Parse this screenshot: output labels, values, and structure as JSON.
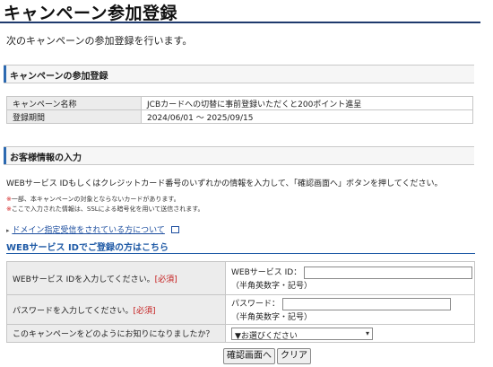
{
  "page": {
    "title": "キャンペーン参加登録",
    "intro": "次のキャンペーンの参加登録を行います。"
  },
  "campaign_section": {
    "heading": "キャンペーンの参加登録",
    "rows": [
      {
        "label": "キャンペーン名称",
        "value": "JCBカードへの切替に事前登録いただくと200ポイント進呈"
      },
      {
        "label": "登録期間",
        "value": "2024/06/01 ～ 2025/09/15"
      }
    ]
  },
  "customer_section": {
    "heading": "お客様情報の入力",
    "description": "WEBサービス IDもしくはクレジットカード番号のいずれかの情報を入力して、「確認画面へ」ボタンを押してください。",
    "notes": [
      {
        "mark": "※",
        "text": "一部、本キャンペーンの対象とならないカードがあります。"
      },
      {
        "mark": "※",
        "text": "ここで入力された情報は、SSLによる暗号化を用いて送信されます。"
      }
    ],
    "domain_link": "ドメイン指定受信をされている方について",
    "web_id_heading": "WEBサービス IDでご登録の方はこちら"
  },
  "form": {
    "web_id": {
      "label": "WEBサービス IDを入力してください。",
      "required": "[必須]",
      "field_label": "WEBサービス ID：",
      "hint": "（半角英数字・記号）",
      "value": ""
    },
    "password": {
      "label": "パスワードを入力してください。",
      "required": "[必須]",
      "field_label": "パスワード：",
      "hint": "（半角英数字・記号）",
      "value": ""
    },
    "source": {
      "label": "このキャンペーンをどのようにお知りになりましたか？",
      "selected": "▼お選びください"
    }
  },
  "buttons": {
    "confirm": "確認画面へ",
    "clear": "クリア"
  }
}
